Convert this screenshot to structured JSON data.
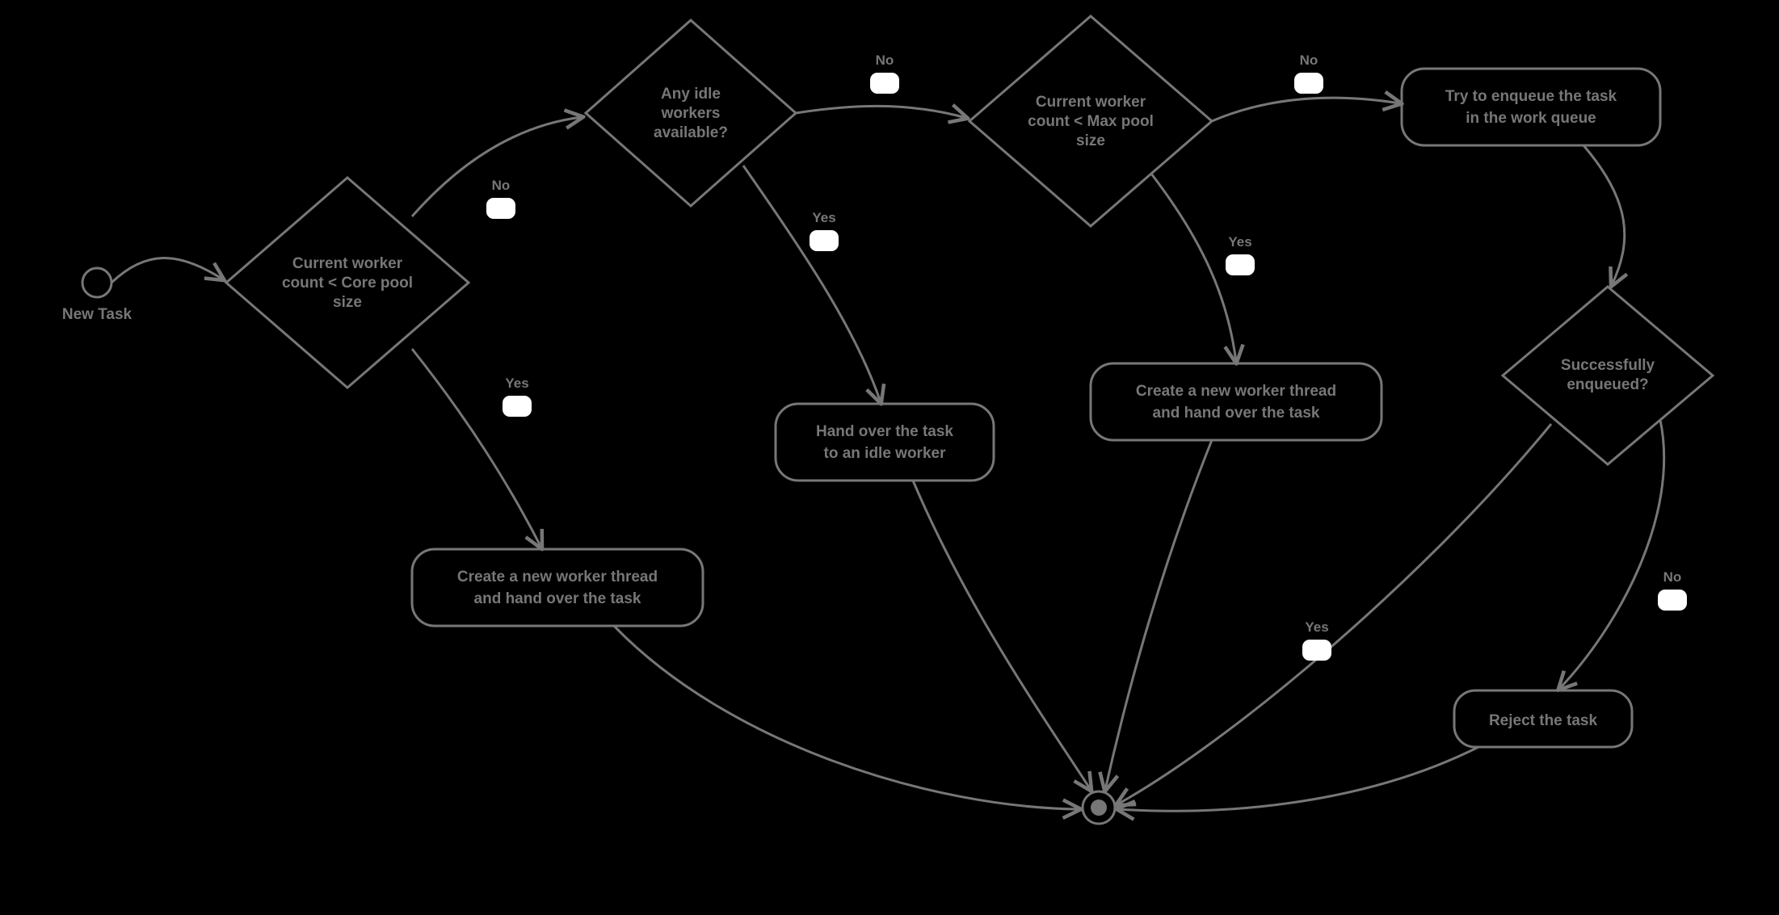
{
  "start": {
    "label": "New Task"
  },
  "d1": {
    "line1": "Current worker",
    "line2": "count < Core pool",
    "line3": "size"
  },
  "d2": {
    "line1": "Any idle",
    "line2": "workers",
    "line3": "available?"
  },
  "d3": {
    "line1": "Current worker",
    "line2": "count < Max pool",
    "line3": "size"
  },
  "d4": {
    "line1": "Successfully",
    "line2": "enqueued?"
  },
  "a1": {
    "line1": "Create a new worker thread",
    "line2": "and hand over the task"
  },
  "a2": {
    "line1": "Hand over the task",
    "line2": "to an idle worker"
  },
  "a3": {
    "line1": "Create a new worker thread",
    "line2": "and hand over the task"
  },
  "a4": {
    "line1": "Try to enqueue the task",
    "line2": "in the work queue"
  },
  "a5": {
    "line1": "Reject the task"
  },
  "labels": {
    "no": "No",
    "yes": "Yes"
  }
}
